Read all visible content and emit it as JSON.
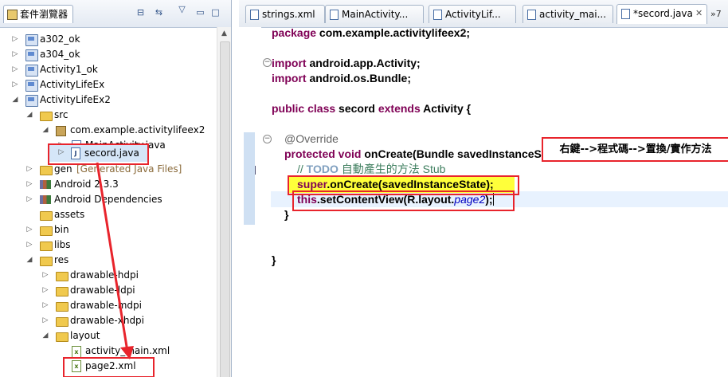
{
  "explorer": {
    "title": "套件瀏覽器",
    "items": [
      {
        "label": "a302_ok"
      },
      {
        "label": "a304_ok"
      },
      {
        "label": "Activity1_ok"
      },
      {
        "label": "ActivityLifeEx"
      },
      {
        "label": "ActivityLifeEx2"
      },
      {
        "label": "src"
      },
      {
        "label": "com.example.activitylifeex2"
      },
      {
        "label": "MainActivity.java"
      },
      {
        "label": "secord.java"
      },
      {
        "label": "gen",
        "decoration": "[Generated Java Files]"
      },
      {
        "label": "Android 2.3.3"
      },
      {
        "label": "Android Dependencies"
      },
      {
        "label": "assets"
      },
      {
        "label": "bin"
      },
      {
        "label": "libs"
      },
      {
        "label": "res"
      },
      {
        "label": "drawable-hdpi"
      },
      {
        "label": "drawable-ldpi"
      },
      {
        "label": "drawable-mdpi"
      },
      {
        "label": "drawable-xhdpi"
      },
      {
        "label": "layout"
      },
      {
        "label": "activity_main.xml"
      },
      {
        "label": "page2.xml"
      }
    ]
  },
  "editor": {
    "tabs": [
      {
        "label": "strings.xml"
      },
      {
        "label": "MainActivity..."
      },
      {
        "label": "ActivityLif..."
      },
      {
        "label": "activity_mai..."
      },
      {
        "label": "*secord.java"
      }
    ],
    "overflow": "»7",
    "code": {
      "l1_kw": "package",
      "l1_rest": " com.example.activitylifeex2;",
      "l3_kw": "import",
      "l3_rest": " android.app.Activity;",
      "l4_kw": "import",
      "l4_rest": " android.os.Bundle;",
      "l6_kw1": "public class",
      "l6_name": " secord ",
      "l6_kw2": "extends",
      "l6_rest": " Activity {",
      "l8_ann": "@Override",
      "l9_kw": "protected void",
      "l9_rest": " onCreate(Bundle savedInstanceState) {",
      "l10_cmt": "// ",
      "l10_todo": "TODO",
      "l10_cmt2": " 自動產生的方法 Stub",
      "l11_kw": "super",
      "l11_rest": ".onCreate(savedInstanceState);",
      "l12_kw": "this",
      "l12_rest": ".setContentView(R.layout.",
      "l12_ital": "page2",
      "l12_end": ");",
      "l13": "}",
      "l16": "}"
    }
  },
  "annotation": {
    "callout": "右鍵-->程式碼-->置換/實作方法"
  },
  "colors": {
    "highlight_red": "#e8242c",
    "keyword": "#7f0055",
    "comment": "#3f7f5f",
    "yellow": "#ffff3a"
  }
}
